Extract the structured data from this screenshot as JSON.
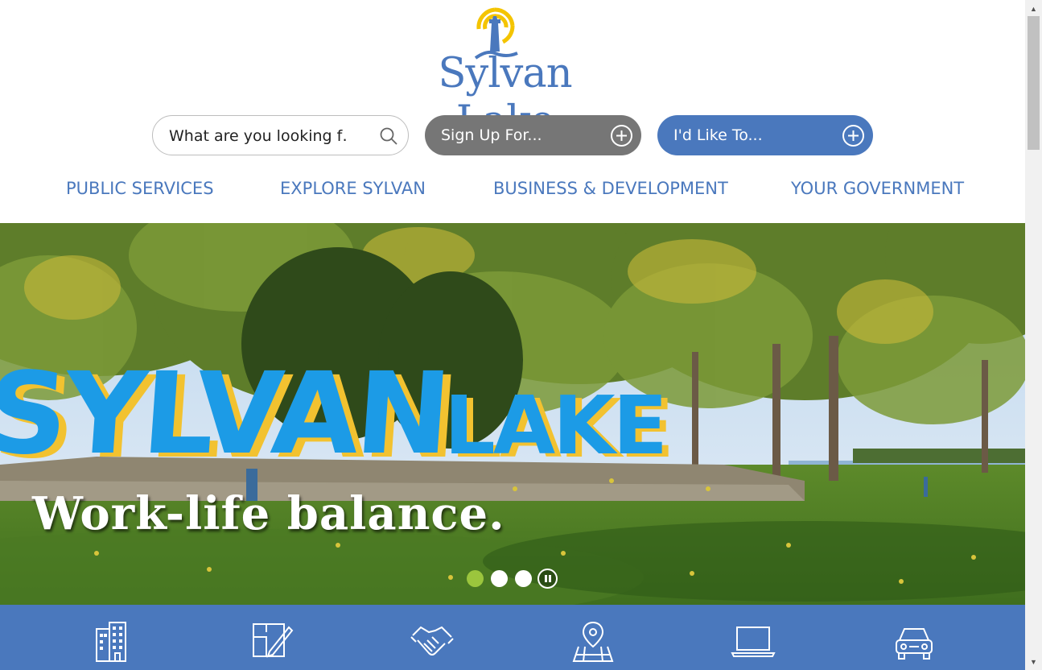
{
  "brand": {
    "name": "Sylvan Lake",
    "colors": {
      "primary": "#4a78bd",
      "accent_yellow": "#f4c400",
      "grey_pill": "#767676",
      "dot_active": "#9bc53d"
    }
  },
  "search": {
    "placeholder": "What are you looking f…",
    "icon": "search-icon"
  },
  "actions": {
    "signup_label": "Sign Up For...",
    "like_label": "I'd Like To...",
    "icon": "plus-circle-icon"
  },
  "nav": {
    "items": [
      "PUBLIC SERVICES",
      "EXPLORE SYLVAN",
      "BUSINESS & DEVELOPMENT",
      "YOUR GOVERNMENT"
    ]
  },
  "hero": {
    "sign_text": "SYLVAN LAKE",
    "caption": "Work-life balance.",
    "slides_total": 3,
    "active_slide": 1,
    "pause_icon": "pause-icon"
  },
  "quick_links": {
    "icons": [
      "building-icon",
      "blueprint-pencil-icon",
      "handshake-icon",
      "map-pin-icon",
      "laptop-icon",
      "car-icon"
    ]
  }
}
